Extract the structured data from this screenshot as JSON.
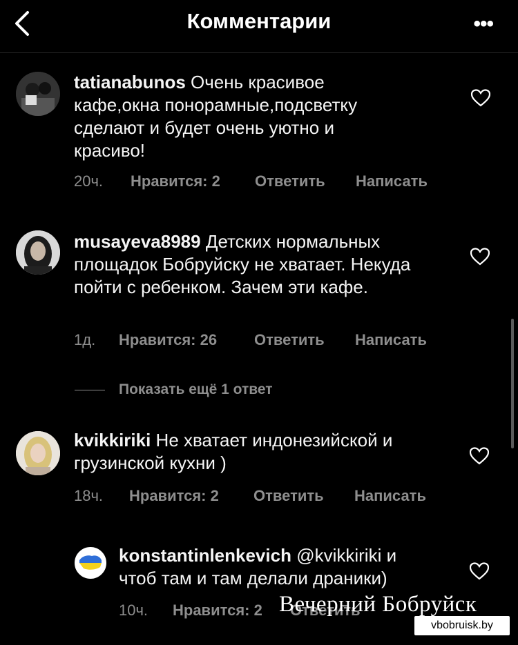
{
  "header": {
    "title": "Комментарии",
    "back_icon": "chevron-left-icon",
    "more_icon": "more-horizontal-icon",
    "more_label": "•••"
  },
  "comments": [
    {
      "username": "tatianabunos",
      "text": "Очень красивое кафе,окна понорамные,подсветку сделают и будет очень уютно и красиво!",
      "time": "20ч.",
      "likes": "Нравится: 2",
      "reply": "Ответить",
      "message": "Написать"
    },
    {
      "username": "musayeva8989",
      "text": "Детских нормальных площадок Бобруйску не хватает. Некуда пойти с ребенком.  Зачем эти кафе.",
      "time": "1д.",
      "likes": "Нравится: 26",
      "reply": "Ответить",
      "message": "Написать"
    },
    {
      "username": "kvikkiriki",
      "text": "Не хватает индонезийской и грузинской кухни )",
      "time": "18ч.",
      "likes": "Нравится: 2",
      "reply": "Ответить",
      "message": "Написать"
    }
  ],
  "show_more_replies": "Показать ещё 1 ответ",
  "reply": {
    "username": "konstantinlenkevich",
    "text": "@kvikkiriki и чтоб там и там  делали драники)",
    "time": "10ч.",
    "likes": "Нравится: 2",
    "reply": "Ответить"
  },
  "watermark": {
    "title": "Вечерний Бобруйск",
    "site": "vbobruisk.by"
  },
  "colors": {
    "background": "#000000",
    "meta_text": "#8e8e8e",
    "flag_blue": "#2f6fd8",
    "flag_yellow": "#f5d21b"
  }
}
